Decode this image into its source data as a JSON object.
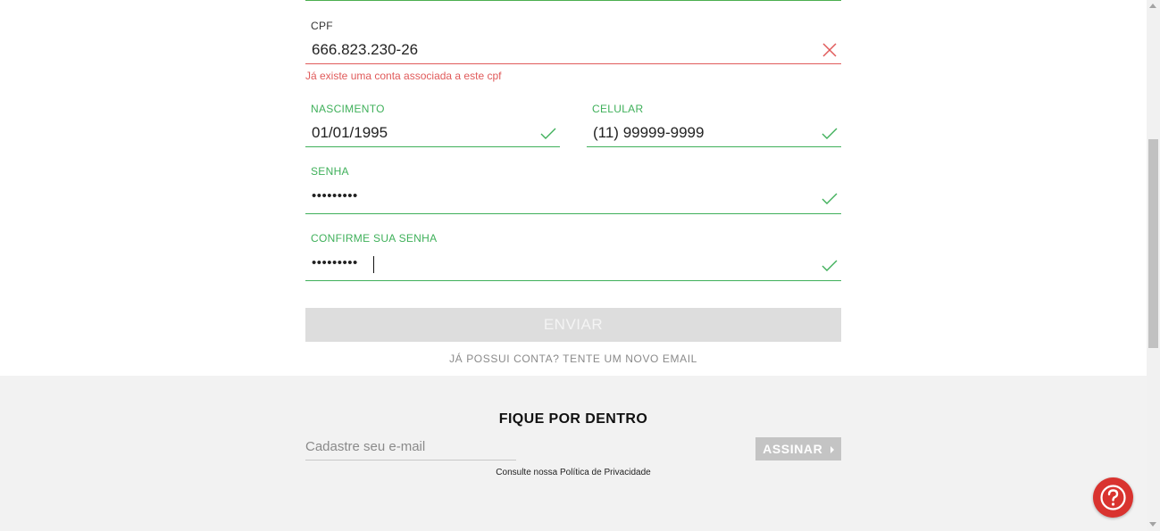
{
  "form": {
    "cpf": {
      "label": "CPF",
      "value": "666.823.230-26",
      "status": "error",
      "error": "Já existe uma conta associada a este cpf"
    },
    "nascimento": {
      "label": "NASCIMENTO",
      "value": "01/01/1995",
      "status": "valid"
    },
    "celular": {
      "label": "CELULAR",
      "value": "(11) 99999-9999",
      "status": "valid"
    },
    "senha": {
      "label": "SENHA",
      "value": "•••••••••",
      "status": "valid"
    },
    "confirme_senha": {
      "label": "CONFIRME SUA SENHA",
      "value": "•••••••••",
      "status": "valid"
    },
    "submit_label": "ENVIAR",
    "login_link": "JÁ POSSUI CONTA? TENTE UM NOVO EMAIL"
  },
  "newsletter": {
    "title": "FIQUE POR DENTRO",
    "placeholder": "Cadastre seu e-mail",
    "button_label": "ASSINAR",
    "privacy_text": "Consulte nossa Política de Privacidade"
  },
  "help": {
    "icon": "question-icon"
  },
  "colors": {
    "valid": "#3fb05a",
    "error": "#e05a5a",
    "help": "#d9332f"
  }
}
